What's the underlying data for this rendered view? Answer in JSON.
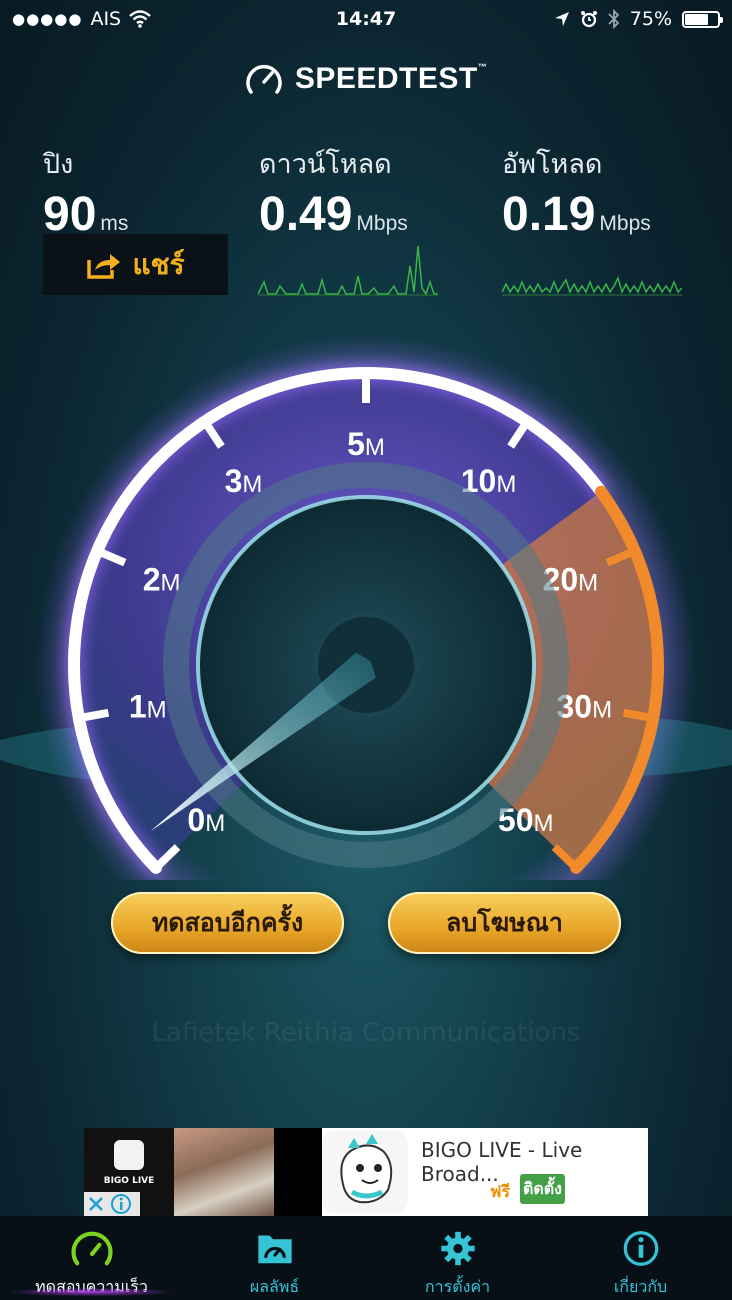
{
  "status_bar": {
    "signal_dots": "●●●●●",
    "carrier": "AIS",
    "time": "14:47",
    "battery": "75%",
    "battery_level": 0.75
  },
  "brand": {
    "name": "SPEEDTEST",
    "tm": "™"
  },
  "metrics": {
    "ping": {
      "label": "ปิง",
      "value": "90",
      "unit": "ms"
    },
    "download": {
      "label": "ดาวน์โหลด",
      "value": "0.49",
      "unit": "Mbps"
    },
    "upload": {
      "label": "อัพโหลด",
      "value": "0.19",
      "unit": "Mbps"
    }
  },
  "share_button": {
    "label": "แชร์"
  },
  "gauge": {
    "ticks": [
      {
        "n": "0",
        "u": "M"
      },
      {
        "n": "1",
        "u": "M"
      },
      {
        "n": "2",
        "u": "M"
      },
      {
        "n": "3",
        "u": "M"
      },
      {
        "n": "5",
        "u": "M"
      },
      {
        "n": "10",
        "u": "M"
      },
      {
        "n": "20",
        "u": "M"
      },
      {
        "n": "30",
        "u": "M"
      },
      {
        "n": "50",
        "u": "M"
      }
    ],
    "needle_value": 0.19,
    "colors": {
      "rim": "#ffffff",
      "glow": "#9b6cff",
      "fill": "#4b3a9c",
      "upload_sector": "#f08a2a",
      "needle": "#7fe6f5"
    }
  },
  "buttons": {
    "retest": "ทดสอบอีกครั้ง",
    "remove_ads": "ลบโฆษณา"
  },
  "watermark": "Lafietek Reithia Communications",
  "ad": {
    "brand": "BIGO LIVE",
    "title": "BIGO LIVE - Live Broad...",
    "price": "ฟรี",
    "install": "ติดตั้ง"
  },
  "tabs": [
    {
      "label": "ทดสอบความเร็ว",
      "icon": "speedometer-icon"
    },
    {
      "label": "ผลลัพธ์",
      "icon": "results-folder-icon"
    },
    {
      "label": "การตั้งค่า",
      "icon": "gear-icon"
    },
    {
      "label": "เกี่ยวกับ",
      "icon": "info-icon"
    }
  ]
}
